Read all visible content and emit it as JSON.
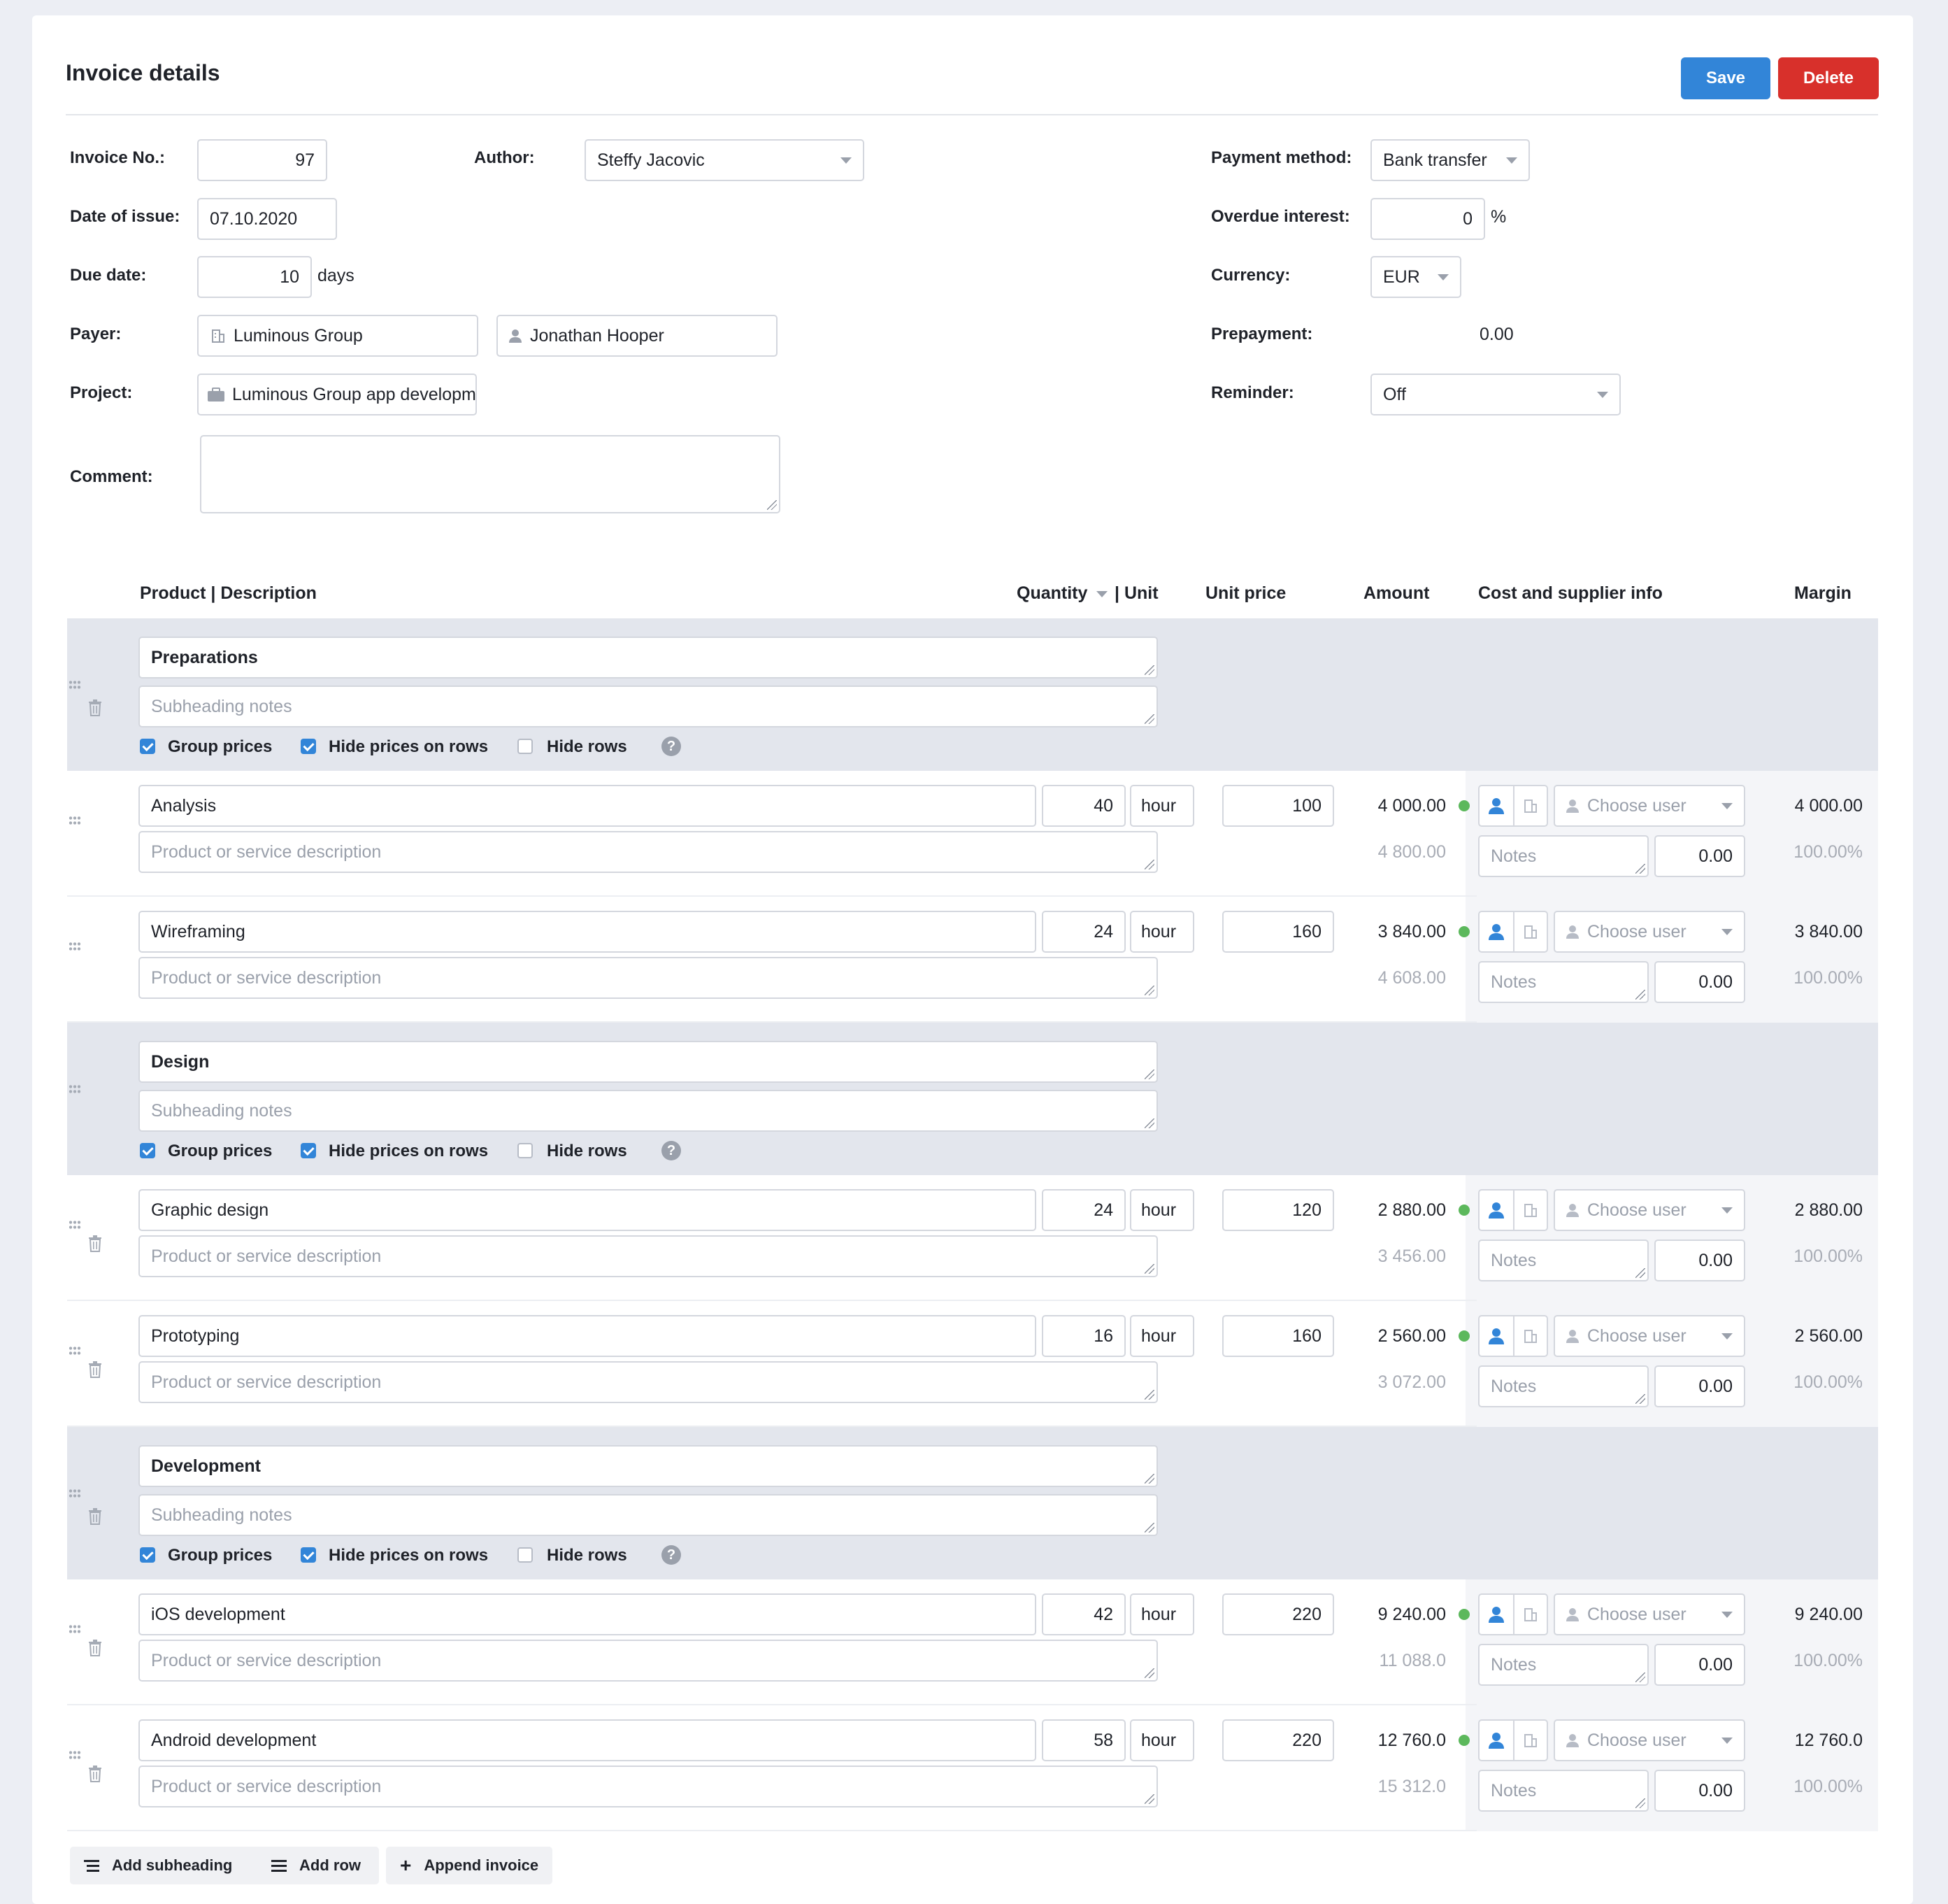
{
  "header": {
    "title": "Invoice details",
    "save_label": "Save",
    "delete_label": "Delete"
  },
  "form": {
    "invoice_no_label": "Invoice No.:",
    "invoice_no": "97",
    "author_label": "Author:",
    "author": "Steffy Jacovic",
    "date_label": "Date of issue:",
    "date": "07.10.2020",
    "due_label": "Due date:",
    "due": "10",
    "due_unit": "days",
    "payer_label": "Payer:",
    "payer_company": "Luminous Group",
    "payer_person": "Jonathan Hooper",
    "project_label": "Project:",
    "project": "Luminous Group app developm",
    "comment_label": "Comment:",
    "payment_method_label": "Payment method:",
    "payment_method": "Bank transfer",
    "overdue_label": "Overdue interest:",
    "overdue": "0",
    "overdue_unit": "%",
    "currency_label": "Currency:",
    "currency": "EUR",
    "prepayment_label": "Prepayment:",
    "prepayment": "0.00",
    "reminder_label": "Reminder:",
    "reminder": "Off"
  },
  "table": {
    "col_product": "Product | Description",
    "col_quantity": "Quantity",
    "col_unit": "| Unit",
    "col_unit_price": "Unit price",
    "col_amount": "Amount",
    "col_cost": "Cost and supplier info",
    "col_margin": "Margin",
    "subheading_placeholder": "Subheading notes",
    "description_placeholder": "Product or service description",
    "group_prices_label": "Group prices",
    "hide_prices_label": "Hide prices on rows",
    "hide_rows_label": "Hide rows",
    "help_glyph": "?",
    "choose_user_placeholder": "Choose user",
    "notes_placeholder": "Notes",
    "status_color": "#5cb85c"
  },
  "sections": [
    {
      "title": "Preparations",
      "group_prices": true,
      "hide_prices": true,
      "hide_rows": false
    },
    {
      "title": "Design",
      "group_prices": true,
      "hide_prices": true,
      "hide_rows": false
    },
    {
      "title": "Development",
      "group_prices": true,
      "hide_prices": true,
      "hide_rows": false
    }
  ],
  "rows": [
    {
      "name": "Analysis",
      "qty": "40",
      "unit": "hour",
      "price": "100",
      "amount": "4 000.00",
      "amount_tax": "4 800.00",
      "cost": "0.00",
      "margin": "4 000.00",
      "margin_pct": "100.00%"
    },
    {
      "name": "Wireframing",
      "qty": "24",
      "unit": "hour",
      "price": "160",
      "amount": "3 840.00",
      "amount_tax": "4 608.00",
      "cost": "0.00",
      "margin": "3 840.00",
      "margin_pct": "100.00%"
    },
    {
      "name": "Graphic design",
      "qty": "24",
      "unit": "hour",
      "price": "120",
      "amount": "2 880.00",
      "amount_tax": "3 456.00",
      "cost": "0.00",
      "margin": "2 880.00",
      "margin_pct": "100.00%"
    },
    {
      "name": "Prototyping",
      "qty": "16",
      "unit": "hour",
      "price": "160",
      "amount": "2 560.00",
      "amount_tax": "3 072.00",
      "cost": "0.00",
      "margin": "2 560.00",
      "margin_pct": "100.00%"
    },
    {
      "name": "iOS development",
      "qty": "42",
      "unit": "hour",
      "price": "220",
      "amount": "9 240.00",
      "amount_tax": "11 088.0",
      "cost": "0.00",
      "margin": "9 240.00",
      "margin_pct": "100.00%"
    },
    {
      "name": "Android development",
      "qty": "58",
      "unit": "hour",
      "price": "220",
      "amount": "12 760.0",
      "amount_tax": "15 312.0",
      "cost": "0.00",
      "margin": "12 760.0",
      "margin_pct": "100.00%"
    }
  ],
  "footer": {
    "add_subheading": "Add subheading",
    "add_row": "Add row",
    "append_invoice": "Append invoice"
  },
  "colors": {
    "accent": "#3285d8",
    "danger": "#d8302b",
    "section_bg": "#e3e6ed",
    "margin_green": "#1f2229"
  }
}
